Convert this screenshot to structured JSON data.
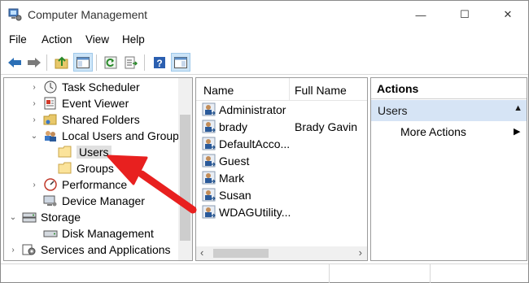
{
  "window": {
    "title": "Computer Management",
    "controls": {
      "minimize": "—",
      "maximize": "☐",
      "close": "✕"
    }
  },
  "menu": {
    "items": [
      "File",
      "Action",
      "View",
      "Help"
    ]
  },
  "tree": {
    "items": [
      {
        "label": "Task Scheduler",
        "icon": "clock-icon",
        "expand": "›"
      },
      {
        "label": "Event Viewer",
        "icon": "event-viewer-icon",
        "expand": "›"
      },
      {
        "label": "Shared Folders",
        "icon": "shared-folder-icon",
        "expand": "›"
      },
      {
        "label": "Local Users and Groups",
        "icon": "users-groups-icon",
        "expand": "⌄"
      },
      {
        "label": "Users",
        "icon": "folder-icon",
        "expand": ""
      },
      {
        "label": "Groups",
        "icon": "folder-icon",
        "expand": ""
      },
      {
        "label": "Performance",
        "icon": "performance-icon",
        "expand": "›"
      },
      {
        "label": "Device Manager",
        "icon": "device-manager-icon",
        "expand": ""
      },
      {
        "label": "Storage",
        "icon": "storage-icon",
        "expand": "⌄"
      },
      {
        "label": "Disk Management",
        "icon": "disk-icon",
        "expand": ""
      },
      {
        "label": "Services and Applications",
        "icon": "services-icon",
        "expand": "›"
      }
    ]
  },
  "list": {
    "columns": [
      "Name",
      "Full Name"
    ],
    "rows": [
      {
        "name": "Administrator",
        "full_name": ""
      },
      {
        "name": "brady",
        "full_name": "Brady Gavin"
      },
      {
        "name": "DefaultAcco...",
        "full_name": ""
      },
      {
        "name": "Guest",
        "full_name": ""
      },
      {
        "name": "Mark",
        "full_name": ""
      },
      {
        "name": "Susan",
        "full_name": ""
      },
      {
        "name": "WDAGUtility...",
        "full_name": ""
      }
    ],
    "scroll_left": "‹",
    "scroll_right": "›"
  },
  "actions": {
    "heading": "Actions",
    "section": "Users",
    "section_toggle": "▲",
    "more_actions": "More Actions",
    "more_arrow": "▶"
  },
  "colors": {
    "annotation_arrow": "#e8201f",
    "selection": "#d6e4f5"
  }
}
